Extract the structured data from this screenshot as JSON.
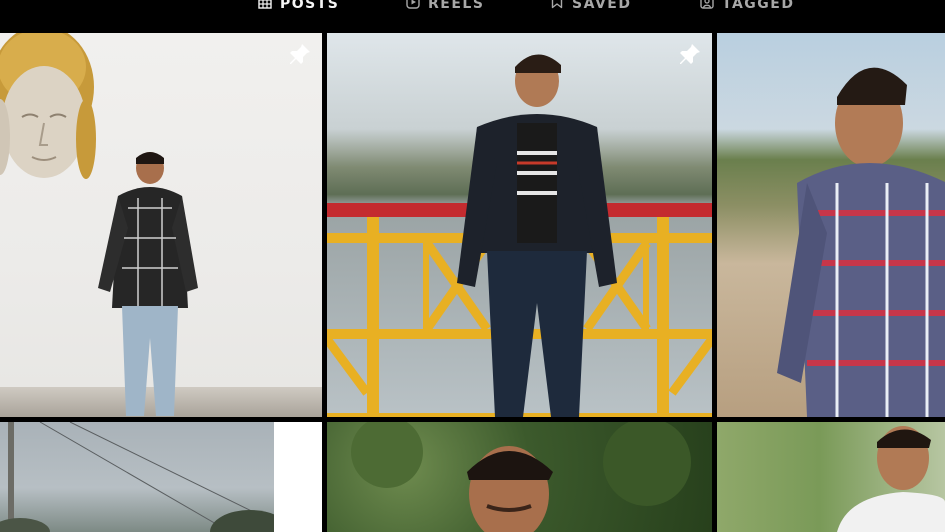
{
  "profile_tabs": [
    {
      "label": "POSTS",
      "icon": "grid-icon",
      "active": true
    },
    {
      "label": "REELS",
      "icon": "reels-icon",
      "active": false
    },
    {
      "label": "SAVED",
      "icon": "bookmark-icon",
      "active": false
    },
    {
      "label": "TAGGED",
      "icon": "tagged-icon",
      "active": false
    }
  ],
  "posts": [
    {
      "badge": "pin-icon"
    },
    {
      "badge": "pin-icon"
    },
    {
      "badge": ""
    },
    {
      "badge": ""
    },
    {
      "badge": "carousel-icon"
    },
    {
      "badge": ""
    }
  ],
  "colors": {
    "background": "#000000",
    "tab_active": "#f5f5f5",
    "tab_inactive": "#a8a8a8",
    "railing_yellow": "#e8b023",
    "railing_red": "#c42b2f"
  }
}
